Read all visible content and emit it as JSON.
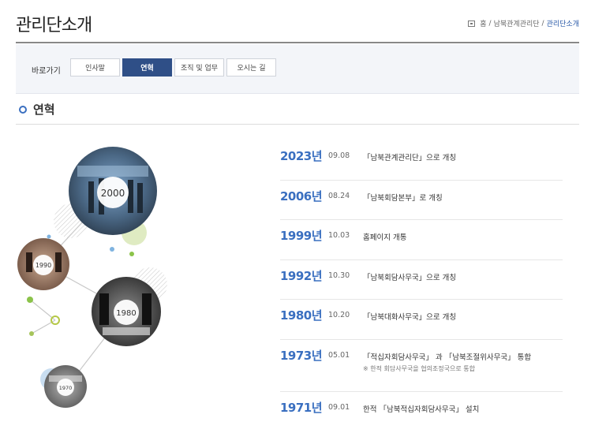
{
  "header": {
    "title": "관리단소개",
    "breadcrumb": [
      "홈",
      "남북관계관리단",
      "관리단소개"
    ]
  },
  "quicknav": {
    "label": "바로가기",
    "tabs": [
      {
        "label": "인사말",
        "active": false
      },
      {
        "label": "연혁",
        "active": true
      },
      {
        "label": "조직 및 업무",
        "active": false
      },
      {
        "label": "오시는 길",
        "active": false
      }
    ]
  },
  "section": {
    "title": "연혁"
  },
  "photo_circles": [
    "2000",
    "1990",
    "1980",
    "1970"
  ],
  "timeline": [
    {
      "year": "2023년",
      "date": "09.08",
      "desc": "「남북관계관리단」으로 개칭",
      "note": ""
    },
    {
      "year": "2006년",
      "date": "08.24",
      "desc": "「남북회담본부」로 개칭",
      "note": ""
    },
    {
      "year": "1999년",
      "date": "10.03",
      "desc": "홈페이지 개통",
      "note": ""
    },
    {
      "year": "1992년",
      "date": "10.30",
      "desc": "「남북회담사무국」으로 개칭",
      "note": ""
    },
    {
      "year": "1980년",
      "date": "10.20",
      "desc": "「남북대화사무국」으로 개칭",
      "note": ""
    },
    {
      "year": "1973년",
      "date": "05.01",
      "desc": "「적십자회담사무국」 과 「남북조절위사무국」 통합",
      "note": "※ 한적 회담사무국을 협의조정국으로 통합"
    },
    {
      "year": "1971년",
      "date": "09.01",
      "desc": "한적 「남북적십자회담사무국」 설치",
      "note": ""
    }
  ],
  "colors": {
    "accent": "#3a6fc0",
    "nav_active": "#2f4f87",
    "nav_bg": "#f3f5f9"
  }
}
